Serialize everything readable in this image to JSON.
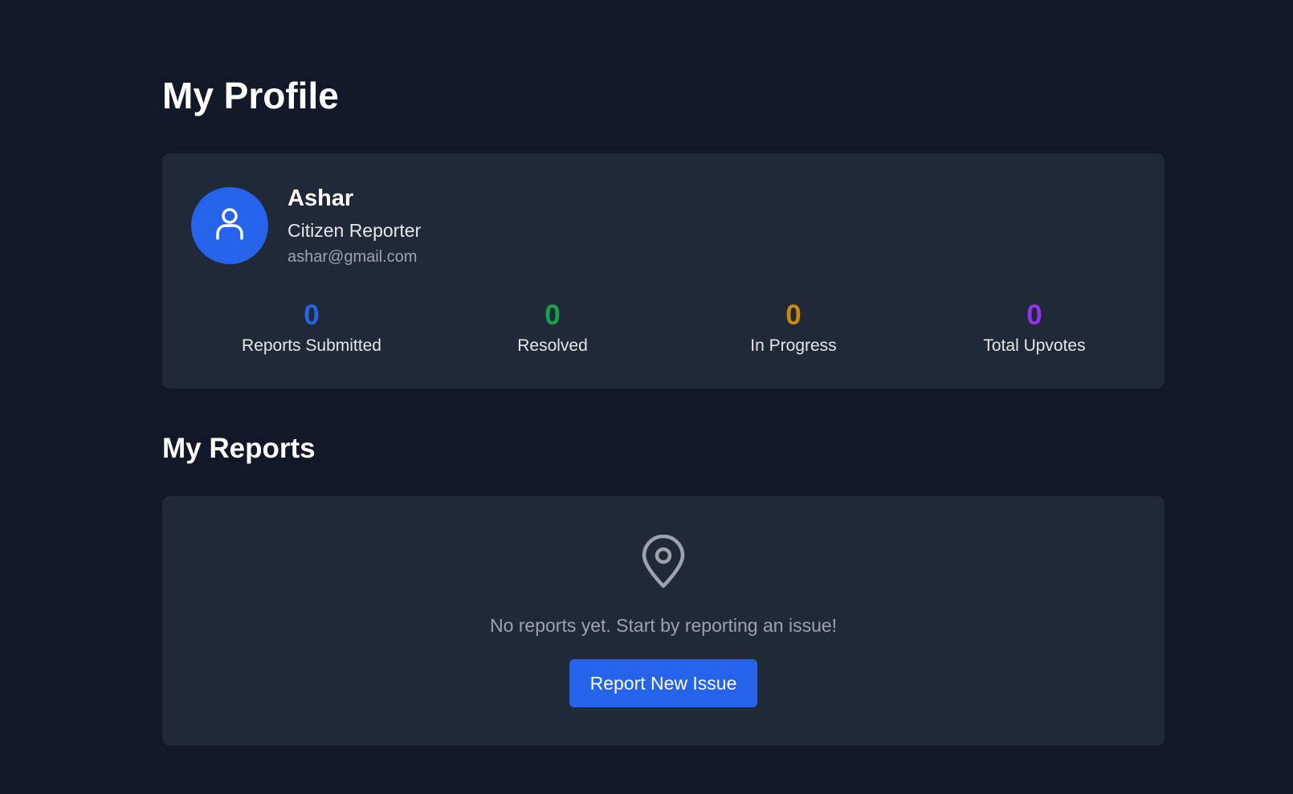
{
  "page": {
    "title": "My Profile"
  },
  "profile": {
    "name": "Ashar",
    "role": "Citizen Reporter",
    "email": "ashar@gmail.com",
    "avatar_icon": "user-icon",
    "avatar_color": "#2563eb"
  },
  "stats": [
    {
      "value": "0",
      "label": "Reports Submitted",
      "color": "#2563eb"
    },
    {
      "value": "0",
      "label": "Resolved",
      "color": "#16a34a"
    },
    {
      "value": "0",
      "label": "In Progress",
      "color": "#ca8a04"
    },
    {
      "value": "0",
      "label": "Total Upvotes",
      "color": "#9333ea"
    }
  ],
  "reports": {
    "title": "My Reports",
    "empty_icon": "map-pin-icon",
    "empty_message": "No reports yet. Start by reporting an issue!",
    "button_label": "Report New Issue",
    "button_color": "#2563eb"
  }
}
